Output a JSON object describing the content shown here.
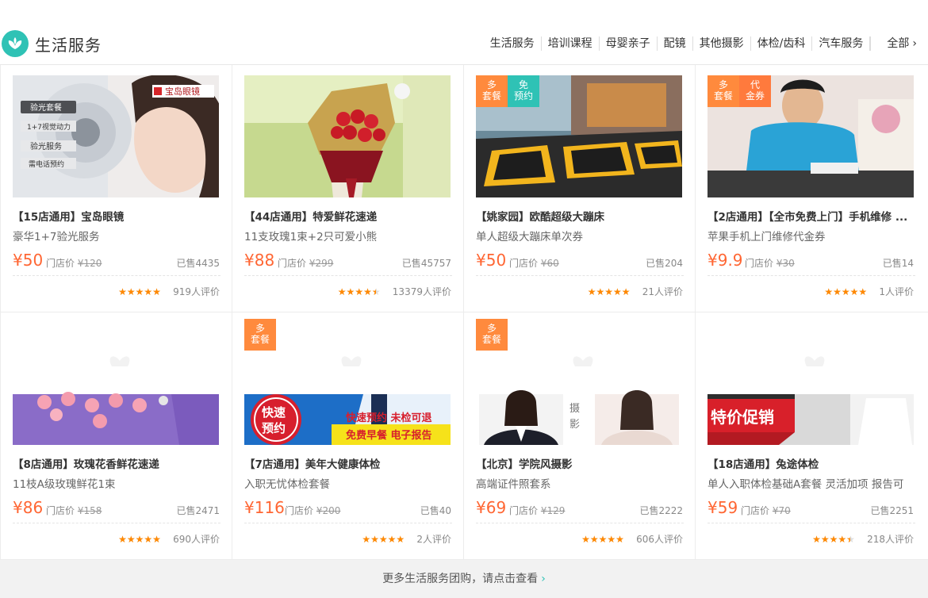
{
  "header": {
    "title": "生活服务",
    "nav": [
      "生活服务",
      "培训课程",
      "母婴亲子",
      "配镜",
      "其他摄影",
      "体检/齿科",
      "汽车服务"
    ],
    "all_label": "全部",
    "accent_color": "#2fc2b5"
  },
  "labels": {
    "store_price_prefix": "门店价",
    "sold_prefix": "已售",
    "review_suffix": "人评价"
  },
  "deals": [
    {
      "title": "【15店通用】宝岛眼镜",
      "subtitle": "豪华1+7验光服务",
      "price": "¥50",
      "store_price": "¥120",
      "sold": "4435",
      "reviews": "919",
      "rating": 4.5,
      "badges": [],
      "image_text": [
        "宝岛眼镜",
        "验光套餐",
        "1+7视觉动力",
        "验光服务",
        "需电话预约"
      ]
    },
    {
      "title": "【44店通用】特爱鲜花速递",
      "subtitle": "11支玫瑰1束+2只可爱小熊",
      "price": "¥88",
      "store_price": "¥299",
      "sold": "45757",
      "reviews": "13379",
      "rating": 4.0,
      "badges": []
    },
    {
      "title": "【姚家园】欧酷超级大蹦床",
      "subtitle": "单人超级大蹦床单次券",
      "price": "¥50",
      "store_price": "¥60",
      "sold": "204",
      "reviews": "21",
      "rating": 4.5,
      "badges": [
        {
          "text": "多\n套餐",
          "color": "orange"
        },
        {
          "text": "免\n预约",
          "color": "teal"
        }
      ]
    },
    {
      "title": "【2店通用】【全市免费上门】手机维修 ...",
      "subtitle": "苹果手机上门维修代金券",
      "price": "¥9.9",
      "store_price": "¥30",
      "sold": "14",
      "reviews": "1",
      "rating": 5.0,
      "badges": [
        {
          "text": "多\n套餐",
          "color": "orange"
        },
        {
          "text": "代\n金券",
          "color": "orange"
        }
      ]
    },
    {
      "title": "【8店通用】玫瑰花香鲜花速递",
      "subtitle": "11枝A级玫瑰鲜花1束",
      "price": "¥86",
      "store_price": "¥158",
      "sold": "2471",
      "reviews": "690",
      "rating": 4.5,
      "badges": []
    },
    {
      "title": "【7店通用】美年大健康体检",
      "subtitle": "入职无忧体检套餐",
      "price": "¥116",
      "store_price": "¥200",
      "sold": "40",
      "reviews": "2",
      "rating": 5.0,
      "badges": [
        {
          "text": "多\n套餐",
          "color": "orange"
        }
      ],
      "image_text": [
        "快速",
        "预约",
        "快速预约 未检可退",
        "免费早餐 电子报告"
      ]
    },
    {
      "title": "【北京】学院风摄影",
      "subtitle": "高端证件照套系",
      "price": "¥69",
      "store_price": "¥129",
      "sold": "2222",
      "reviews": "606",
      "rating": 5.0,
      "badges": [
        {
          "text": "多\n套餐",
          "color": "orange"
        }
      ],
      "image_text": [
        "摄",
        "影"
      ]
    },
    {
      "title": "【18店通用】兔途体检",
      "subtitle": "单人入职体检基础A套餐 灵活加项 报告可",
      "price": "¥59",
      "store_price": "¥70",
      "sold": "2251",
      "reviews": "218",
      "rating": 4.0,
      "badges": [],
      "image_text": [
        "特价促销"
      ]
    }
  ],
  "footer": {
    "text": "更多生活服务团购，请点击查看"
  }
}
